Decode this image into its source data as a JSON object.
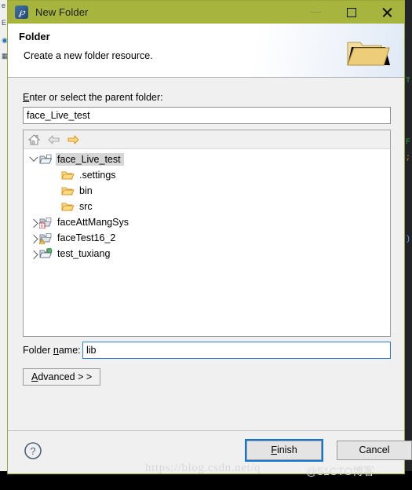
{
  "window": {
    "title": "New Folder",
    "app_icon": "eclipse-icon",
    "icon_glyph": "℘",
    "titlebar_color": "#a7b53e",
    "controls": {
      "minimize": "minimize-button",
      "maximize": "maximize-button",
      "close": "close-button"
    }
  },
  "banner": {
    "title": "Folder",
    "description": "Create a new folder resource.",
    "icon": "open-folder-illustration"
  },
  "form": {
    "parent_label_pre": "",
    "parent_label_accel": "E",
    "parent_label_post": "nter or select the parent folder:",
    "parent_label_full": "Enter or select the parent folder:",
    "parent_value": "face_Live_test",
    "parent_placeholder": "",
    "foldername_label_pre": "Folder ",
    "foldername_label_accel": "n",
    "foldername_label_post": "ame:",
    "foldername_label_full": "Folder name:",
    "foldername_value": "lib",
    "foldername_placeholder": "",
    "advanced_pre": "",
    "advanced_accel": "A",
    "advanced_post": "dvanced  > >",
    "advanced_full": "Advanced >>"
  },
  "tree_toolbar": {
    "home": "home-icon",
    "back": "back-arrow-icon",
    "forward": "forward-arrow-icon",
    "back_enabled": false,
    "forward_enabled": true
  },
  "tree": {
    "items": [
      {
        "label": "face_Live_test",
        "indent": 0,
        "twisty": "down",
        "icon": "open-project-folder",
        "badge": "none",
        "selected": true
      },
      {
        "label": ".settings",
        "indent": 1,
        "twisty": "none",
        "icon": "folder",
        "badge": "none",
        "selected": false
      },
      {
        "label": "bin",
        "indent": 1,
        "twisty": "none",
        "icon": "folder",
        "badge": "none",
        "selected": false
      },
      {
        "label": "src",
        "indent": 1,
        "twisty": "none",
        "icon": "folder",
        "badge": "none",
        "selected": false
      },
      {
        "label": "faceAttMangSys",
        "indent": 0,
        "twisty": "right",
        "icon": "closed-project",
        "badge": "error",
        "selected": false
      },
      {
        "label": "faceTest16_2",
        "indent": 0,
        "twisty": "right",
        "icon": "closed-project",
        "badge": "warning",
        "selected": false
      },
      {
        "label": "test_tuxiang",
        "indent": 0,
        "twisty": "right",
        "icon": "open-project-folder",
        "badge": "ok",
        "selected": false
      }
    ]
  },
  "footer": {
    "help": "help-icon",
    "finish_pre": "",
    "finish_accel": "F",
    "finish_post": "inish",
    "finish_full": "Finish",
    "cancel_label": "Cancel",
    "finish_focused": true
  },
  "watermark": {
    "line1": "https://blog.csdn.net/q",
    "line2": "@51CTO博客"
  },
  "colors": {
    "titlebar": "#a7b53e",
    "dialog_bg": "#f0f0f0",
    "focus_blue": "#1277d4",
    "selection_gray": "#d6d6d6",
    "folder_gold": "#e8b84b"
  }
}
